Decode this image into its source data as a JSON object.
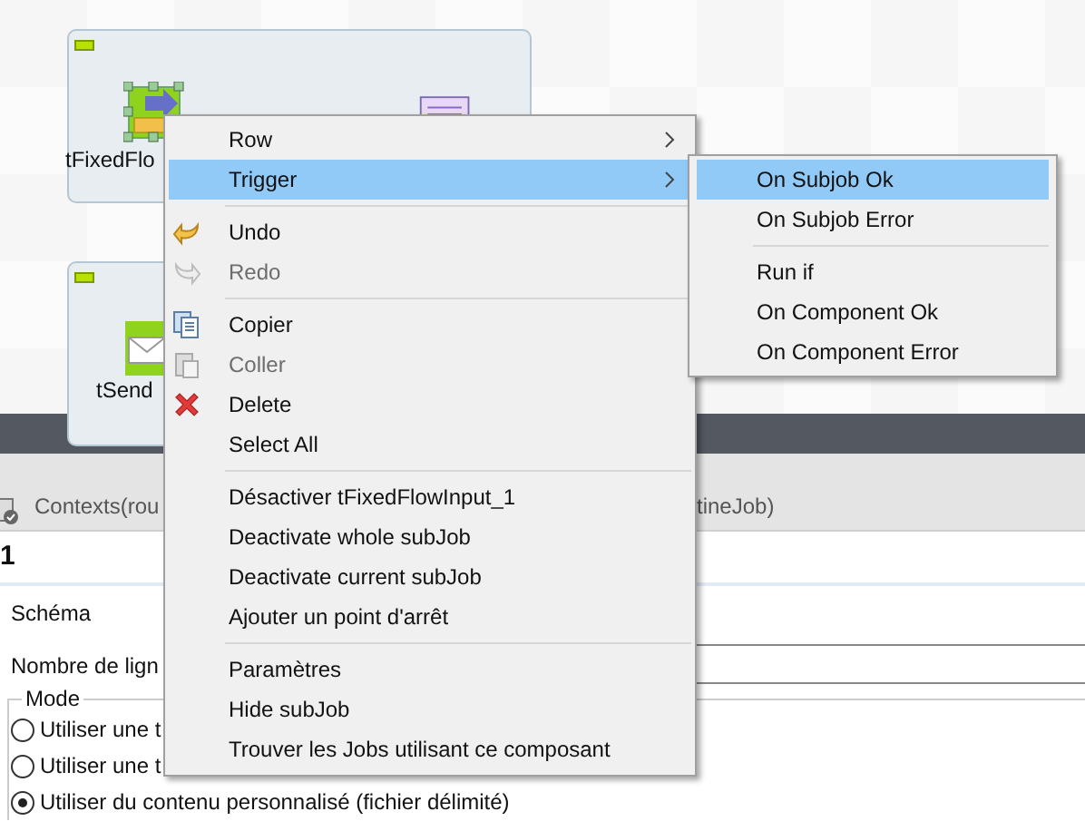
{
  "canvas": {
    "subjobs": [
      {
        "label": "tFixedFlo",
        "kind": "input"
      },
      {
        "label": "tSend",
        "kind": "mail"
      }
    ]
  },
  "panel": {
    "tab_fragments": [
      "Contexts(rou",
      "tineJob)"
    ],
    "heading": "1",
    "fields": [
      "Schéma",
      "Nombre de lign"
    ],
    "mode": {
      "title": "Mode",
      "options": [
        {
          "label": "Utiliser une t",
          "selected": false
        },
        {
          "label": "Utiliser une t",
          "selected": false
        },
        {
          "label": "Utiliser du contenu personnalisé (fichier délimité)",
          "selected": true
        }
      ]
    }
  },
  "context_menu": {
    "items": [
      {
        "kind": "item",
        "label": "Row",
        "submenu": true,
        "selected": false,
        "disabled": false
      },
      {
        "kind": "item",
        "label": "Trigger",
        "submenu": true,
        "selected": true,
        "disabled": false
      },
      {
        "kind": "separator"
      },
      {
        "kind": "undo",
        "label": "Undo",
        "submenu": false,
        "selected": false,
        "disabled": false
      },
      {
        "kind": "redo",
        "label": "Redo",
        "submenu": false,
        "selected": false,
        "disabled": true
      },
      {
        "kind": "separator"
      },
      {
        "kind": "copy",
        "label": "Copier",
        "submenu": false,
        "selected": false,
        "disabled": false
      },
      {
        "kind": "paste",
        "label": "Coller",
        "submenu": false,
        "selected": false,
        "disabled": true
      },
      {
        "kind": "delete",
        "label": "Delete",
        "submenu": false,
        "selected": false,
        "disabled": false
      },
      {
        "kind": "item",
        "label": "Select All",
        "submenu": false,
        "selected": false,
        "disabled": false
      },
      {
        "kind": "separator"
      },
      {
        "kind": "item",
        "label": "Désactiver tFixedFlowInput_1",
        "submenu": false,
        "selected": false,
        "disabled": false
      },
      {
        "kind": "item",
        "label": "Deactivate whole subJob",
        "submenu": false,
        "selected": false,
        "disabled": false
      },
      {
        "kind": "item",
        "label": "Deactivate current subJob",
        "submenu": false,
        "selected": false,
        "disabled": false
      },
      {
        "kind": "item",
        "label": "Ajouter un point d'arrêt",
        "submenu": false,
        "selected": false,
        "disabled": false
      },
      {
        "kind": "separator"
      },
      {
        "kind": "item",
        "label": "Paramètres",
        "submenu": false,
        "selected": false,
        "disabled": false
      },
      {
        "kind": "item",
        "label": "Hide subJob",
        "submenu": false,
        "selected": false,
        "disabled": false
      },
      {
        "kind": "item",
        "label": "Trouver les Jobs utilisant ce composant",
        "submenu": false,
        "selected": false,
        "disabled": false
      }
    ]
  },
  "submenu": {
    "items": [
      {
        "kind": "item",
        "label": "On Subjob Ok",
        "selected": true
      },
      {
        "kind": "item",
        "label": "On Subjob Error",
        "selected": false
      },
      {
        "kind": "separator"
      },
      {
        "kind": "item",
        "label": "Run if",
        "selected": false
      },
      {
        "kind": "item",
        "label": "On Component Ok",
        "selected": false
      },
      {
        "kind": "item",
        "label": "On Component Error",
        "selected": false
      }
    ]
  }
}
